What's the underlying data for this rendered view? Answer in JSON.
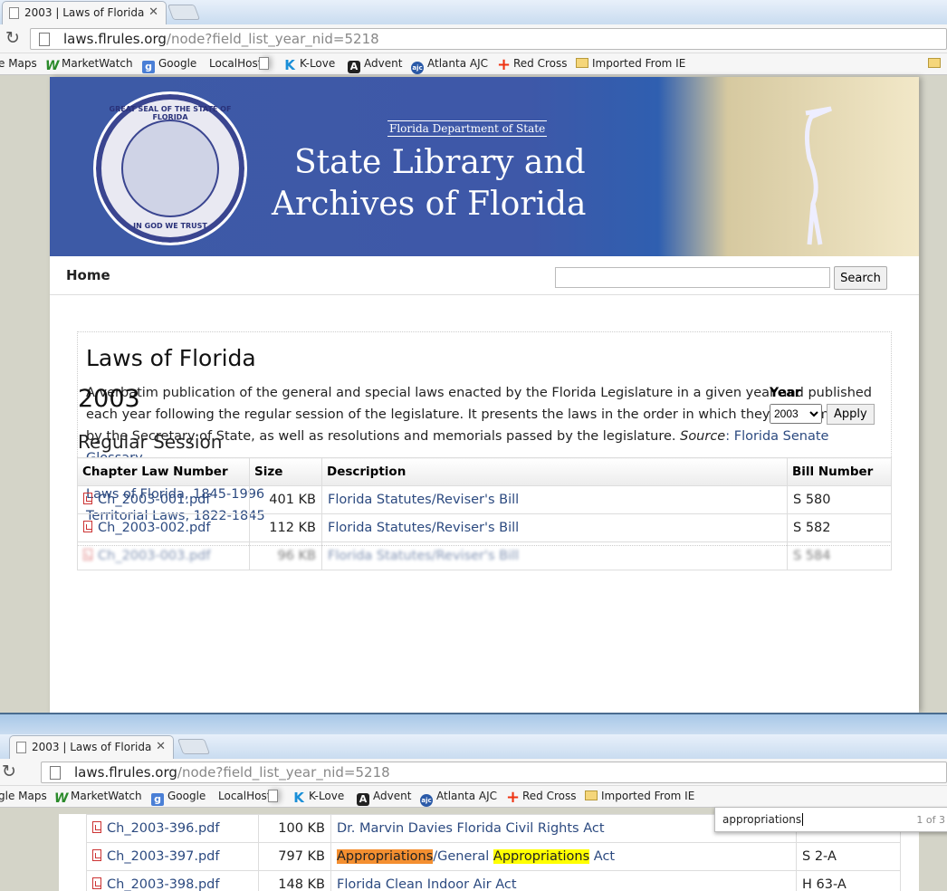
{
  "browser": {
    "tab_title": "2003 | Laws of Florida",
    "url_host": "laws.flrules.org",
    "url_path": "/node?field_list_year_nid=5218",
    "bookmarks_top": [
      "e Maps",
      "MarketWatch",
      "Google",
      "LocalHost",
      "K-Love",
      "Advent",
      "Atlanta AJC",
      "Red Cross",
      "Imported From IE"
    ],
    "bookmarks_bottom": [
      "gle Maps",
      "MarketWatch",
      "Google",
      "LocalHost",
      "K-Love",
      "Advent",
      "Atlanta AJC",
      "Red Cross",
      "Imported From IE"
    ]
  },
  "banner": {
    "dept": "Florida Department of State",
    "title_line1": "State Library and",
    "title_line2": "Archives of Florida",
    "seal_top": "GREAT SEAL OF THE STATE OF FLORIDA",
    "seal_bottom": "IN GOD WE TRUST"
  },
  "nav": {
    "home": "Home",
    "search_button": "Search"
  },
  "intro": {
    "heading": "Laws of Florida",
    "body": "A verbatim publication of the general and special laws enacted by the Florida Legislature in a given year and published each year following the regular session of the legislature. It presents the laws in the order in which they are numbered by the Secretary of State, as well as resolutions and memorials passed by the legislature.",
    "source_label": "Source",
    "source_link": "Florida Senate Glossary",
    "link1": "Laws of Florida, 1845-1996",
    "link2": "Territorial Laws, 1822-1845"
  },
  "year_heading": "2003",
  "year_select": {
    "label": "Year",
    "value": "2003",
    "apply": "Apply"
  },
  "session_heading": "Regular Session",
  "table": {
    "headers": [
      "Chapter Law Number",
      "Size",
      "Description",
      "Bill Number"
    ],
    "rows_top": [
      {
        "file": "Ch_2003-001.pdf",
        "size": "401 KB",
        "desc": "Florida Statutes/Reviser's Bill",
        "bill": "S 580"
      },
      {
        "file": "Ch_2003-002.pdf",
        "size": "112 KB",
        "desc": "Florida Statutes/Reviser's Bill",
        "bill": "S 582"
      },
      {
        "file": "Ch_2003-003.pdf",
        "size": "96 KB",
        "desc": "Florida Statutes/Reviser's Bill",
        "bill": "S 584"
      }
    ],
    "rows_bottom": [
      {
        "file": "Ch_2003-396.pdf",
        "size": "100 KB",
        "desc": "Dr. Marvin Davies Florida Civil Rights Act",
        "bill": ""
      },
      {
        "file": "Ch_2003-397.pdf",
        "size": "797 KB",
        "desc_parts": [
          "Appropriations",
          "/General ",
          "Appropriations",
          " Act"
        ],
        "bill": "S 2-A"
      },
      {
        "file": "Ch_2003-398.pdf",
        "size": "148 KB",
        "desc": "Florida Clean Indoor Air Act",
        "bill": "H 63-A"
      }
    ]
  },
  "find": {
    "query": "appropriations",
    "count": "1 of 3"
  }
}
